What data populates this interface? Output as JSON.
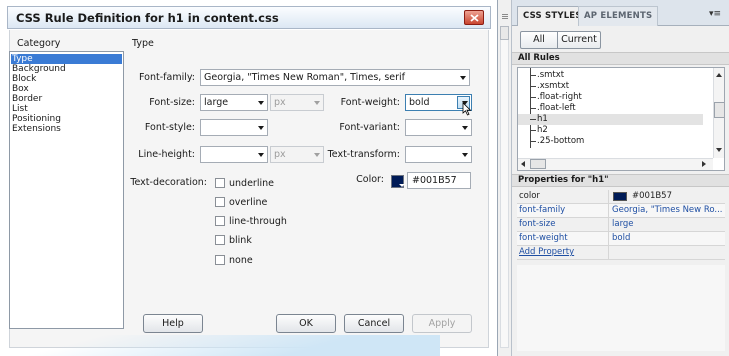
{
  "dialog": {
    "title": "CSS Rule Definition for h1 in content.css",
    "category_heading": "Category",
    "section_heading": "Type",
    "categories": [
      "Type",
      "Background",
      "Block",
      "Box",
      "Border",
      "List",
      "Positioning",
      "Extensions"
    ],
    "selected_category": "Type",
    "fields": {
      "font_family_label": "Font-family:",
      "font_family_value": "Georgia, \"Times New Roman\", Times, serif",
      "font_size_label": "Font-size:",
      "font_size_value": "large",
      "font_size_unit": "px",
      "font_weight_label": "Font-weight:",
      "font_weight_value": "bold",
      "font_style_label": "Font-style:",
      "font_style_value": "",
      "font_variant_label": "Font-variant:",
      "font_variant_value": "",
      "line_height_label": "Line-height:",
      "line_height_value": "",
      "line_height_unit": "px",
      "text_transform_label": "Text-transform:",
      "text_transform_value": "",
      "text_decoration_label": "Text-decoration:",
      "color_label": "Color:",
      "color_value": "#001B57"
    },
    "text_decorations": [
      "underline",
      "overline",
      "line-through",
      "blink",
      "none"
    ],
    "buttons": {
      "help": "Help",
      "ok": "OK",
      "cancel": "Cancel",
      "apply": "Apply"
    }
  },
  "panel": {
    "tabs": [
      "CSS STYLES",
      "AP ELEMENTS"
    ],
    "mode_all": "All",
    "mode_current": "Current",
    "all_rules_heading": "All Rules",
    "rules": [
      ".smtxt",
      ".xsmtxt",
      ".float-right",
      ".float-left",
      "h1",
      "h2",
      ".25-bottom"
    ],
    "selected_rule": "h1",
    "properties_heading": "Properties for \"h1\"",
    "properties": [
      {
        "name": "color",
        "value": "#001B57"
      },
      {
        "name": "font-family",
        "value": "Georgia, \"Times New Ro..."
      },
      {
        "name": "font-size",
        "value": "large"
      },
      {
        "name": "font-weight",
        "value": "bold"
      }
    ],
    "add_property": "Add Property"
  },
  "colors": {
    "selection": "#3a7bd5",
    "h1_color": "#001B57",
    "link": "#1f4fa3",
    "close_button": "#c9452f"
  },
  "icons": [
    "close-icon",
    "dropdown-arrow-icon",
    "color-swatch-icon",
    "panel-options-icon",
    "scroll-arrow-icon"
  ]
}
